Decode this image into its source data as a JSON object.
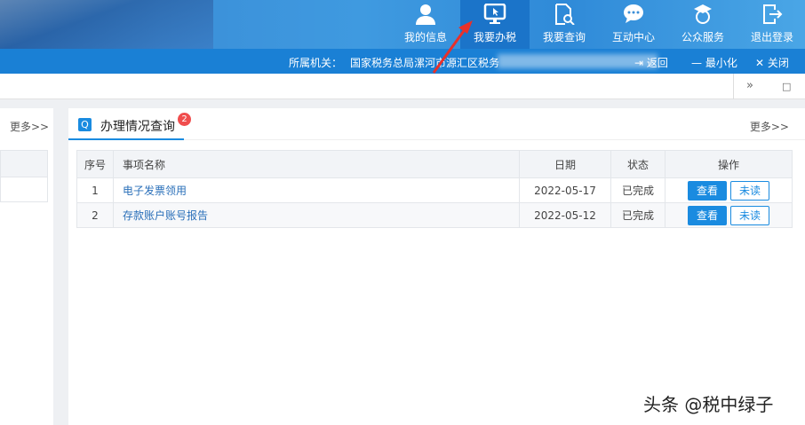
{
  "nav": [
    {
      "label": "我的信息",
      "icon": "user-icon"
    },
    {
      "label": "我要办税",
      "icon": "monitor-icon",
      "active": true
    },
    {
      "label": "我要查询",
      "icon": "doc-search-icon"
    },
    {
      "label": "互动中心",
      "icon": "chat-icon"
    },
    {
      "label": "公众服务",
      "icon": "service-icon"
    },
    {
      "label": "退出登录",
      "icon": "logout-icon"
    }
  ],
  "infobar": {
    "org_label": "所属机关：",
    "org_value": "国家税务总局漯河市源汇区税务",
    "back": "返回",
    "minimize": "最小化",
    "close": "关闭"
  },
  "toolbar": {
    "expand": "»",
    "square": "□"
  },
  "left_panel": {
    "more": "更多>>"
  },
  "panel": {
    "title": "办理情况查询",
    "badge": "2",
    "more": "更多>>",
    "columns": [
      "序号",
      "事项名称",
      "日期",
      "状态",
      "操作"
    ],
    "rows": [
      {
        "no": "1",
        "name": "电子发票领用",
        "date": "2022-05-17",
        "status": "已完成",
        "view": "查看",
        "unread": "未读"
      },
      {
        "no": "2",
        "name": "存款账户账号报告",
        "date": "2022-05-12",
        "status": "已完成",
        "view": "查看",
        "unread": "未读"
      }
    ]
  },
  "watermark": "头条 @税中绿子"
}
